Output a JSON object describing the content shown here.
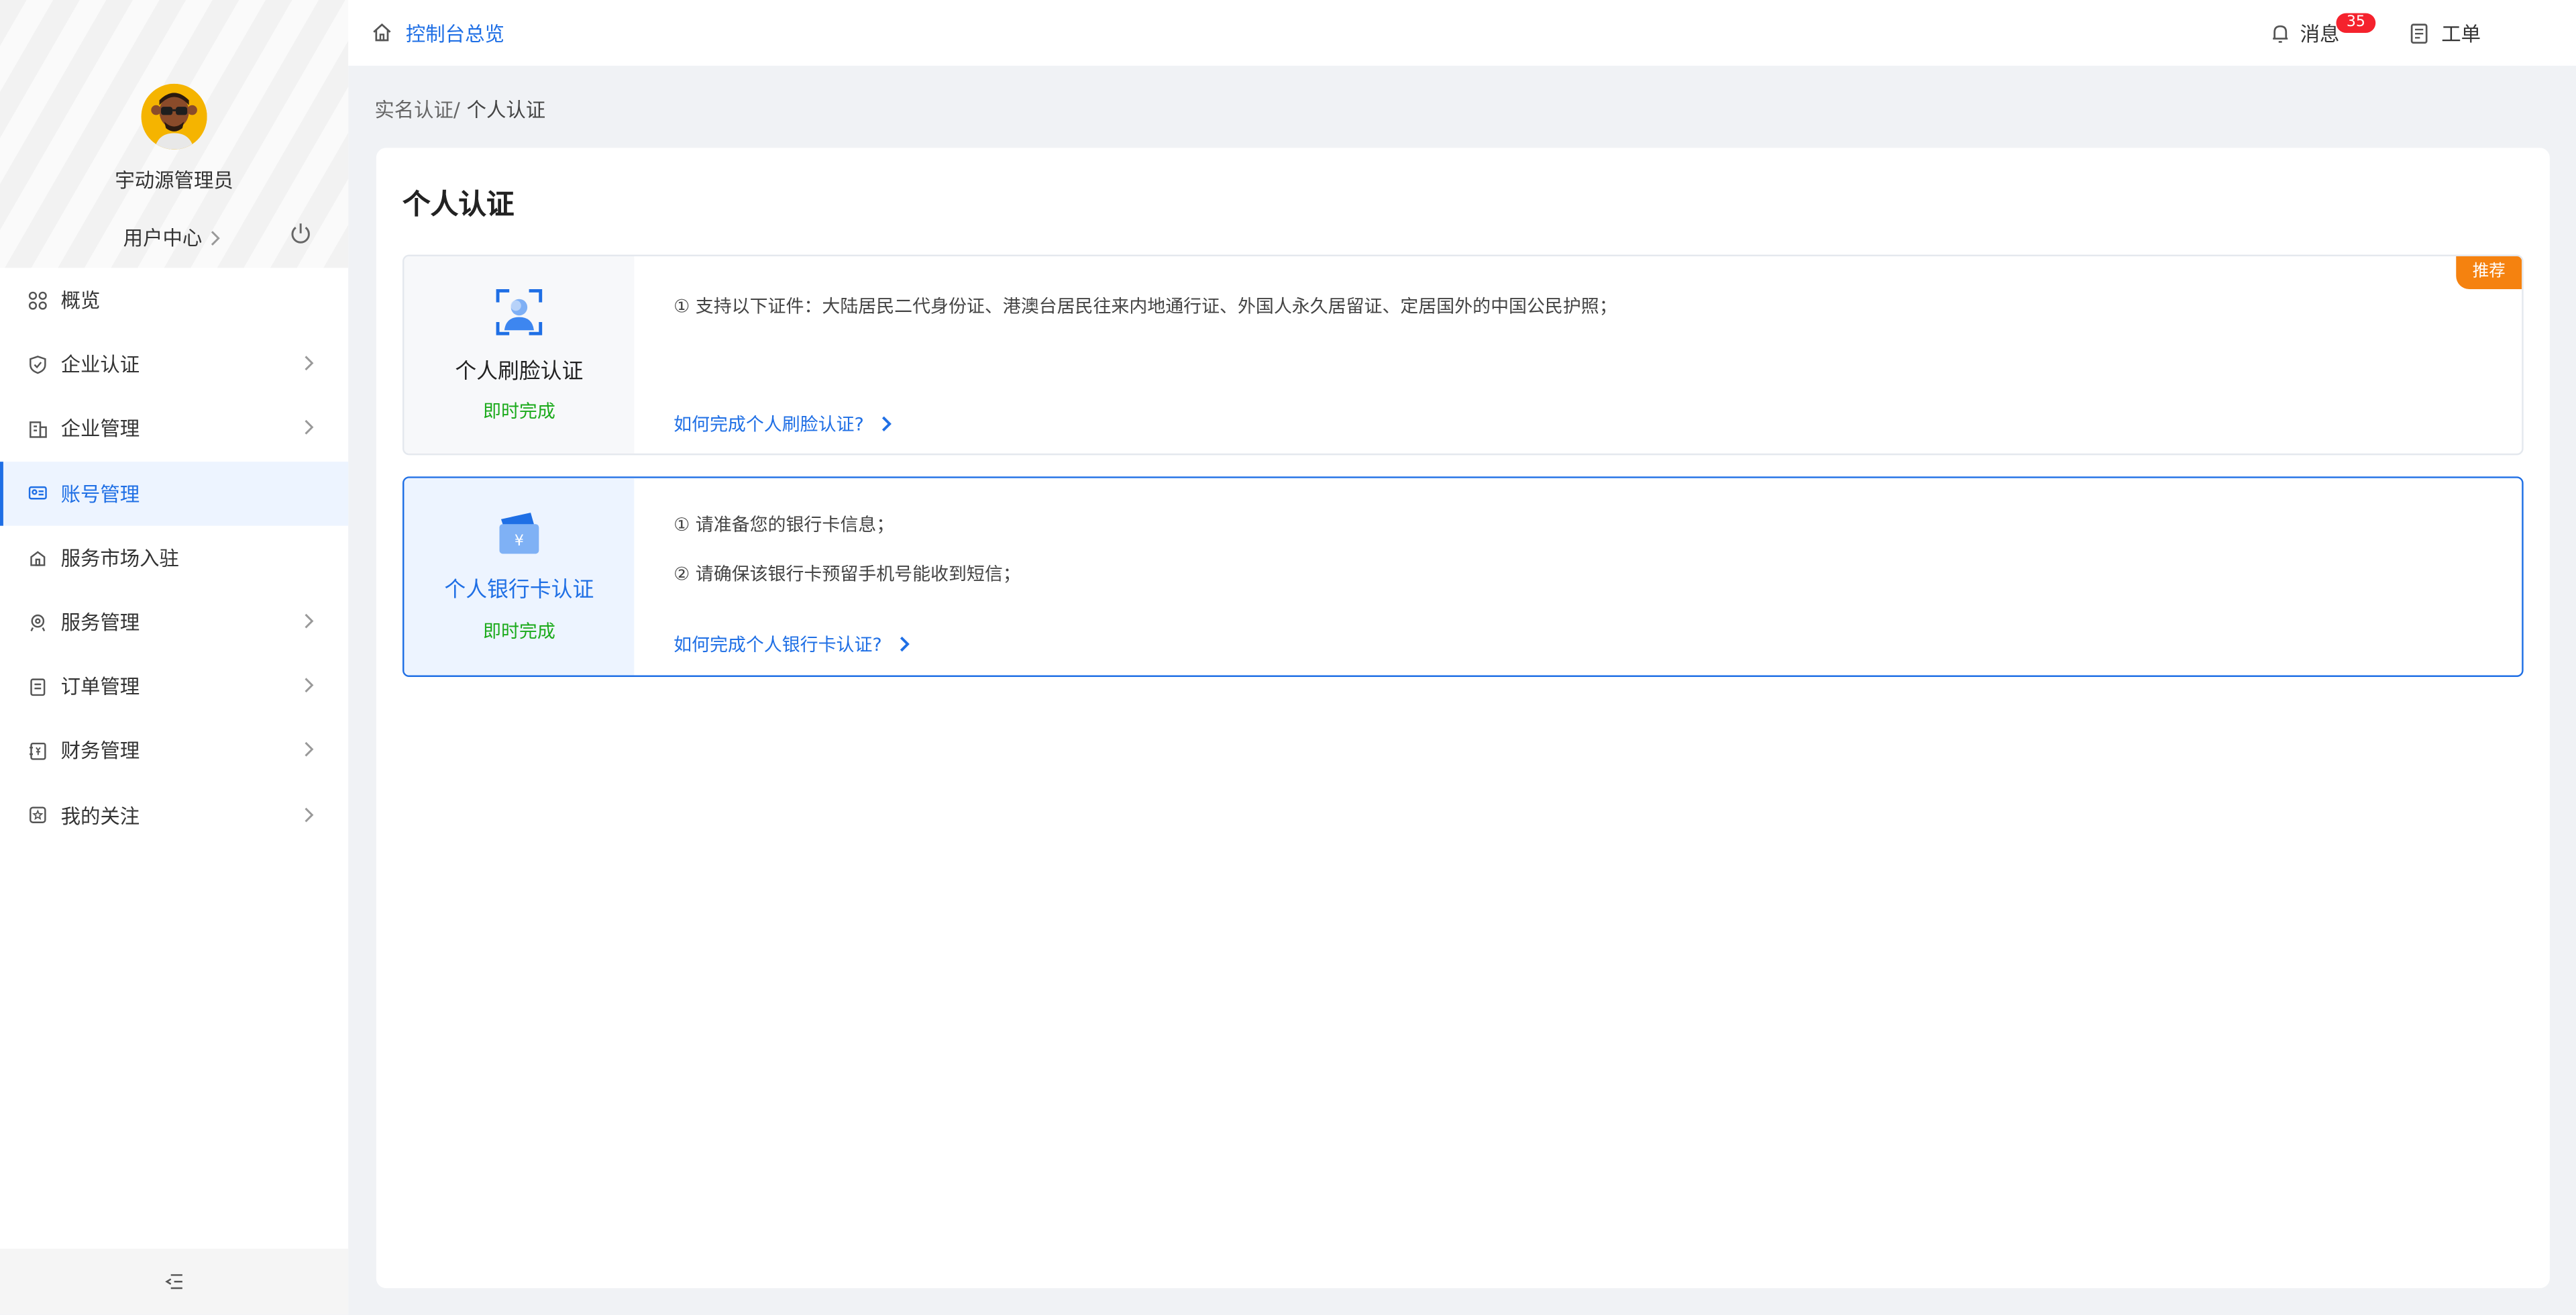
{
  "sidebar": {
    "admin_name": "宇动源管理员",
    "user_center": "用户中心",
    "items": [
      {
        "label": "概览",
        "icon": "overview-icon"
      },
      {
        "label": "企业认证",
        "icon": "shield-icon"
      },
      {
        "label": "企业管理",
        "icon": "building-icon"
      },
      {
        "label": "账号管理",
        "icon": "id-card-icon"
      },
      {
        "label": "服务市场入驻",
        "icon": "store-icon"
      },
      {
        "label": "服务管理",
        "icon": "service-icon"
      },
      {
        "label": "订单管理",
        "icon": "order-icon"
      },
      {
        "label": "财务管理",
        "icon": "finance-icon"
      },
      {
        "label": "我的关注",
        "icon": "star-icon"
      }
    ],
    "active_item": "账号管理"
  },
  "header": {
    "title": "控制台总览",
    "messages_label": "消息",
    "messages_count": "35",
    "ticket_label": "工单"
  },
  "breadcrumb": {
    "parent": "实名认证/",
    "current": "个人认证"
  },
  "main": {
    "title": "个人认证",
    "cards": [
      {
        "name": "个人刷脸认证",
        "status": "即时完成",
        "lines": [
          "① 支持以下证件：大陆居民二代身份证、港澳台居民往来内地通行证、外国人永久居留证、定居国外的中国公民护照；"
        ],
        "link": "如何完成个人刷脸认证?",
        "ribbon": "推荐"
      },
      {
        "name": "个人银行卡认证",
        "status": "即时完成",
        "lines": [
          "① 请准备您的银行卡信息；",
          "② 请确保该银行卡预留手机号能收到短信；"
        ],
        "link": "如何完成个人银行卡认证?"
      }
    ]
  },
  "colors": {
    "accent": "#1f6fe5",
    "success": "#1aaa1a",
    "ribbon": "#f5820f",
    "badge": "#f5222d"
  }
}
